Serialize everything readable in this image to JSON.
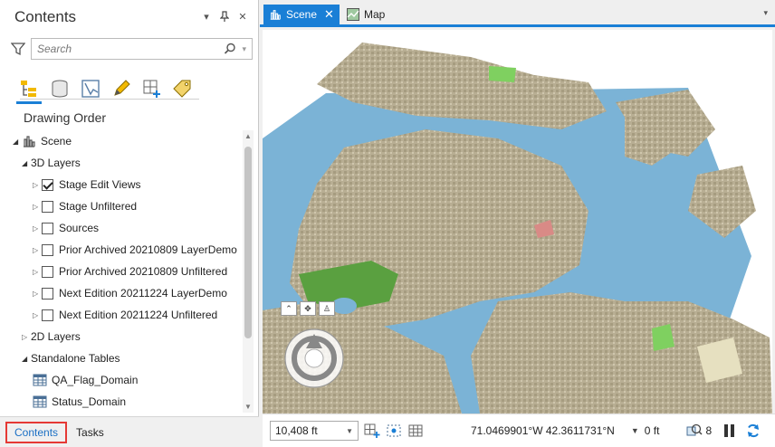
{
  "contents_pane": {
    "title": "Contents",
    "header_buttons": [
      "menu-caret",
      "pin",
      "close"
    ],
    "search": {
      "placeholder": "Search",
      "value": ""
    },
    "tools": [
      "list-by-drawing-order-icon",
      "list-by-data-source-icon",
      "list-by-selection-icon",
      "list-by-editing-icon",
      "list-by-snapping-icon",
      "list-by-labeling-icon"
    ],
    "section_title": "Drawing Order",
    "tree": [
      {
        "label": "Scene",
        "level": 0,
        "expand": "open",
        "icon": "scene-icon"
      },
      {
        "label": "3D Layers",
        "level": 1,
        "expand": "open"
      },
      {
        "label": "Stage Edit Views",
        "level": 2,
        "expand": "closed",
        "checked": true
      },
      {
        "label": "Stage Unfiltered",
        "level": 2,
        "expand": "closed",
        "checked": false
      },
      {
        "label": "Sources",
        "level": 2,
        "expand": "closed",
        "checked": false
      },
      {
        "label": "Prior Archived 20210809 LayerDemo",
        "level": 2,
        "expand": "closed",
        "checked": false
      },
      {
        "label": "Prior Archived 20210809 Unfiltered",
        "level": 2,
        "expand": "closed",
        "checked": false
      },
      {
        "label": "Next Edition 20211224 LayerDemo",
        "level": 2,
        "expand": "closed",
        "checked": false
      },
      {
        "label": "Next Edition 20211224 Unfiltered",
        "level": 2,
        "expand": "closed",
        "checked": false
      },
      {
        "label": "2D Layers",
        "level": 1,
        "expand": "closed"
      },
      {
        "label": "Standalone Tables",
        "level": 1,
        "expand": "open"
      },
      {
        "label": "QA_Flag_Domain",
        "level": 2,
        "icon": "table-icon"
      },
      {
        "label": "Status_Domain",
        "level": 2,
        "icon": "table-icon"
      }
    ],
    "bottom_tabs": {
      "contents": "Contents",
      "tasks": "Tasks"
    }
  },
  "view_tabs": {
    "scene": "Scene",
    "map": "Map"
  },
  "statusbar": {
    "scale": "10,408 ft",
    "coordinates": "71.0469901°W 42.3611731°N",
    "elevation": "0 ft",
    "selected_count": "8"
  },
  "colors": {
    "accent": "#1a7fd6",
    "water": "#7bb3d6",
    "land": "#b7ad92",
    "parks": "#5aa040",
    "highlight_border": "#e53935"
  }
}
